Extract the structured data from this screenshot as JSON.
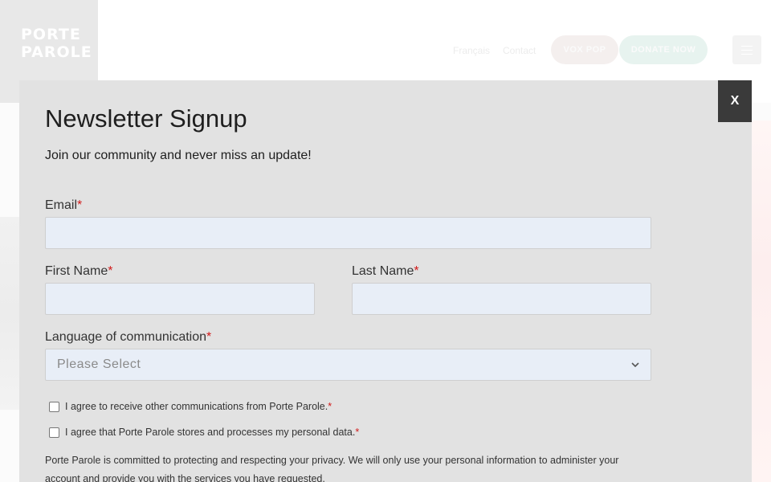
{
  "header": {
    "logo_lines": [
      "PORTE",
      "PAROLE"
    ],
    "nav": {
      "language": "Français",
      "contact": "Contact"
    },
    "voxpop_button": "VOX POP",
    "donate_button": "DONATE NOW"
  },
  "modal": {
    "close_label": "X",
    "title": "Newsletter Signup",
    "subtitle": "Join our community and never miss an update!",
    "required_marker": "*",
    "fields": {
      "email": {
        "label": "Email",
        "value": ""
      },
      "first_name": {
        "label": "First Name",
        "value": ""
      },
      "last_name": {
        "label": "Last Name",
        "value": ""
      },
      "language": {
        "label": "Language of communication",
        "selected": "Please Select"
      }
    },
    "checkboxes": [
      {
        "label": "I agree to receive other communications from Porte Parole.",
        "checked": false
      },
      {
        "label": "I agree that Porte Parole stores and processes my personal data.",
        "checked": false
      }
    ],
    "privacy_text": "Porte Parole is committed to protecting and respecting your privacy. We will only use your personal information to administer your account and provide you with the services you have requested."
  },
  "colors": {
    "modal_bg": "#e2e2e2",
    "close_bg": "#3a3a3a",
    "required": "#d11a1a",
    "input_bg": "#e8eef7"
  },
  "icons": {
    "menu": "hamburger-icon",
    "select": "chevron-down-icon"
  }
}
